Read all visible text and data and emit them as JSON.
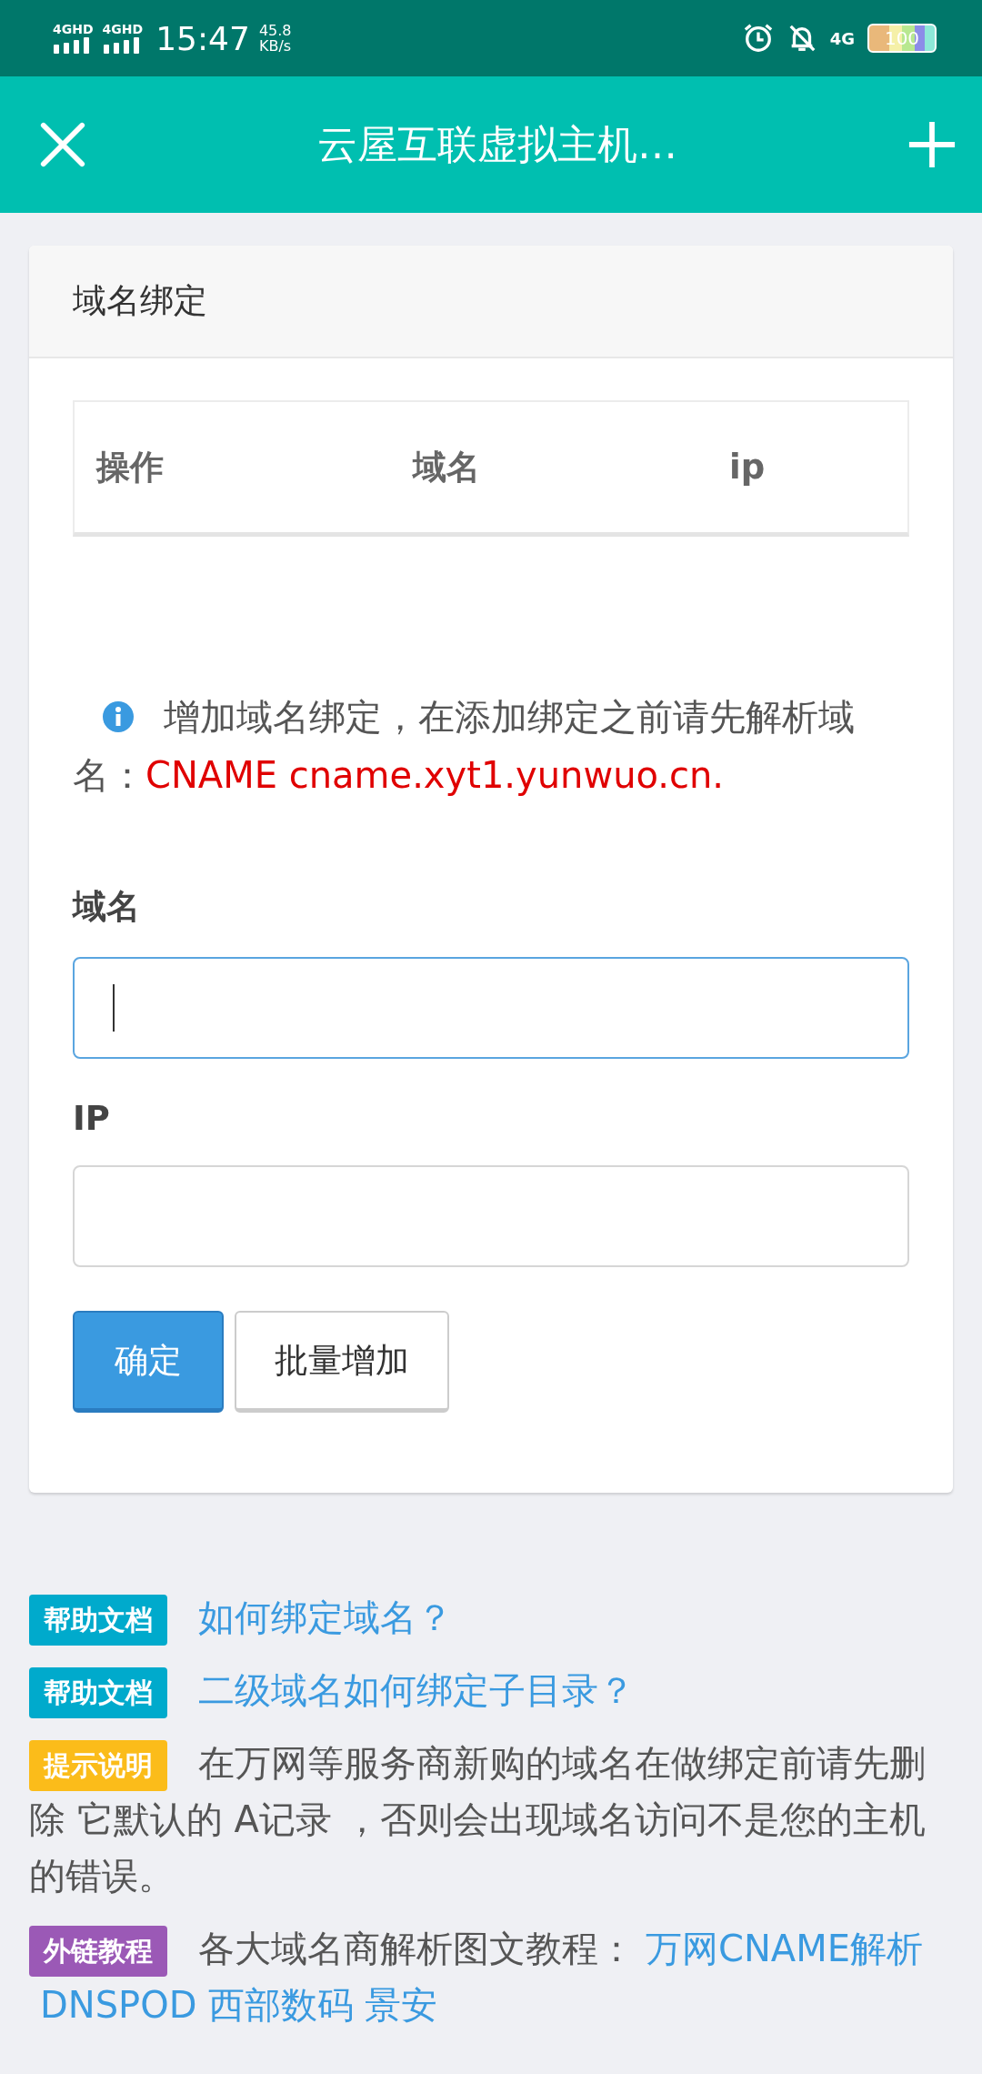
{
  "status_bar": {
    "sims": [
      "4GHD",
      "4GHD"
    ],
    "time": "15:47",
    "speed": "45.8",
    "speed_unit": "KB/s",
    "network": "4G",
    "battery": "100"
  },
  "app_bar": {
    "title": "云屋互联虚拟主机…"
  },
  "card": {
    "title": "域名绑定",
    "table": {
      "columns": [
        "操作",
        "域名",
        "ip"
      ]
    },
    "notice": {
      "text": "增加域名绑定，在添加绑定之前请先解析域名：",
      "highlight": "CNAME cname.xyt1.yunwuo.cn."
    },
    "fields": [
      {
        "label": "域名",
        "focused": true
      },
      {
        "label": "IP",
        "focused": false
      }
    ],
    "buttons": [
      {
        "label": "确定",
        "kind": "primary"
      },
      {
        "label": "批量增加",
        "kind": "default"
      }
    ]
  },
  "help": [
    {
      "tag": "帮助文档",
      "color": "#00aacc",
      "kind": "link",
      "text": "如何绑定域名？"
    },
    {
      "tag": "帮助文档",
      "color": "#00aacc",
      "kind": "link",
      "text": "二级域名如何绑定子目录？"
    },
    {
      "tag": "提示说明",
      "color": "#fbbc1a",
      "kind": "text",
      "text": "在万网等服务商新购的域名在做绑定前请先删除 它默认的 A记录 ，否则会出现域名访问不是您的主机的错误。"
    },
    {
      "tag": "外链教程",
      "color": "#9b59b6",
      "kind": "links",
      "text": "各大域名商解析图文教程：",
      "links": [
        "万网CNAME解析",
        "DNSPOD",
        "西部数码",
        "景安"
      ]
    }
  ]
}
